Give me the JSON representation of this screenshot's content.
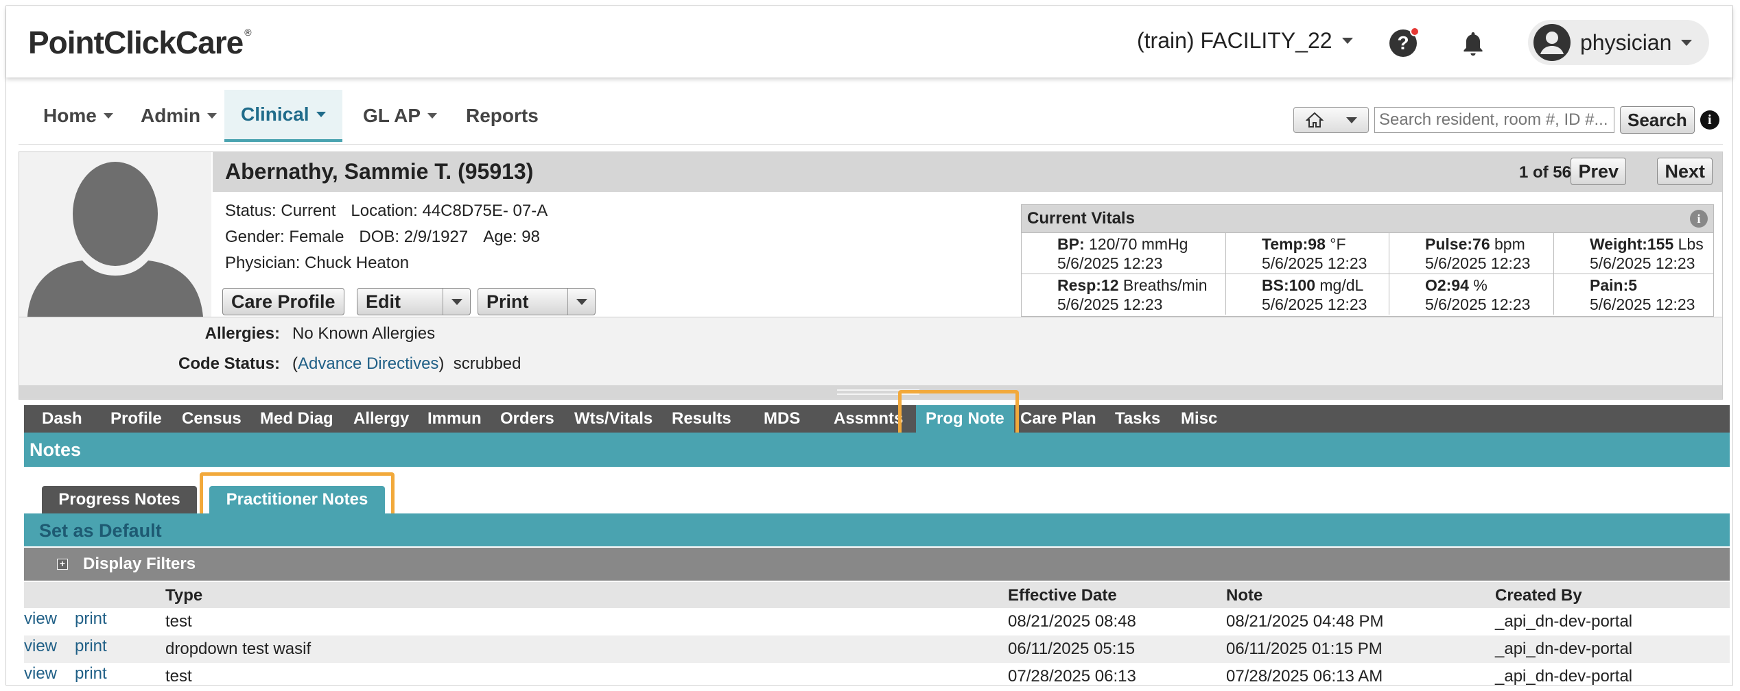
{
  "header": {
    "logo": "PointClickCare",
    "logo_mark": "®",
    "facility": "(train) FACILITY_22",
    "help": "?",
    "user": "physician"
  },
  "nav": {
    "items": [
      {
        "label": "Home"
      },
      {
        "label": "Admin"
      },
      {
        "label": "Clinical"
      },
      {
        "label": "GL AP"
      },
      {
        "label": "Reports"
      }
    ],
    "search_placeholder": "Search resident, room #, ID #...",
    "search_button": "Search",
    "info": "i"
  },
  "resident": {
    "name": "Abernathy, Sammie T. (95913)",
    "count": "1 of 56",
    "prev": "Prev",
    "next": "Next",
    "status": "Status: Current",
    "location": "Location: 44C8D75E- 07-A",
    "gender": "Gender: Female",
    "dob": "DOB: 2/9/1927",
    "age": "Age: 98",
    "physician": "Physician: Chuck Heaton",
    "care_profile": "Care Profile",
    "edit": "Edit",
    "print": "Print",
    "allergies_label": "Allergies:",
    "allergies_value": "No Known Allergies",
    "code_label": "Code Status:",
    "code_open": "(",
    "code_link": "Advance Directives",
    "code_close": ")",
    "code_value": "scrubbed"
  },
  "vitals": {
    "title": "Current Vitals",
    "info": "i",
    "cells": [
      {
        "label": "BP:",
        "value": " 120/70 mmHg",
        "date": "5/6/2025 12:23"
      },
      {
        "label": "Temp:98",
        "value": " °F",
        "date": "5/6/2025 12:23"
      },
      {
        "label": "Pulse:76",
        "value": " bpm",
        "date": "5/6/2025 12:23"
      },
      {
        "label": "Weight:155",
        "value": " Lbs",
        "date": "5/6/2025 12:23"
      },
      {
        "label": "Resp:12",
        "value": " Breaths/min",
        "date": "5/6/2025 12:23"
      },
      {
        "label": "BS:100",
        "value": " mg/dL",
        "date": "5/6/2025 12:23"
      },
      {
        "label": "O2:94",
        "value": " %",
        "date": "5/6/2025 12:23"
      },
      {
        "label": "Pain:5",
        "value": "",
        "date": "5/6/2025 12:23"
      }
    ]
  },
  "chart_tabs": [
    "Dash",
    "Profile",
    "Census",
    "Med Diag",
    "Allergy",
    "Immun",
    "Orders",
    "Wts/Vitals",
    "Results",
    "MDS",
    "Assmnts",
    "Prog Note",
    "Care Plan",
    "Tasks",
    "Misc"
  ],
  "notes": {
    "title": "Notes",
    "tabs": [
      "Progress Notes",
      "Practitioner Notes"
    ],
    "set_default": "Set as Default",
    "plus": "+",
    "display_filters": "Display Filters",
    "columns": [
      "Type",
      "Effective Date",
      "Note",
      "Created By"
    ],
    "rows": [
      {
        "view": "view",
        "print": "print",
        "type": "test",
        "effective": "08/21/2025 08:48",
        "note": "08/21/2025 04:48 PM",
        "created": "_api_dn-dev-portal"
      },
      {
        "view": "view",
        "print": "print",
        "type": "dropdown test wasif",
        "effective": "06/11/2025 05:15",
        "note": "06/11/2025 01:15 PM",
        "created": "_api_dn-dev-portal"
      },
      {
        "view": "view",
        "print": "print",
        "type": "test",
        "effective": "07/28/2025 06:13",
        "note": "07/28/2025 06:13 AM",
        "created": "_api_dn-dev-portal"
      }
    ]
  },
  "colors": {
    "teal": "#4aa3b0",
    "highlight": "#f2a93b",
    "tab_dark": "#555555"
  }
}
